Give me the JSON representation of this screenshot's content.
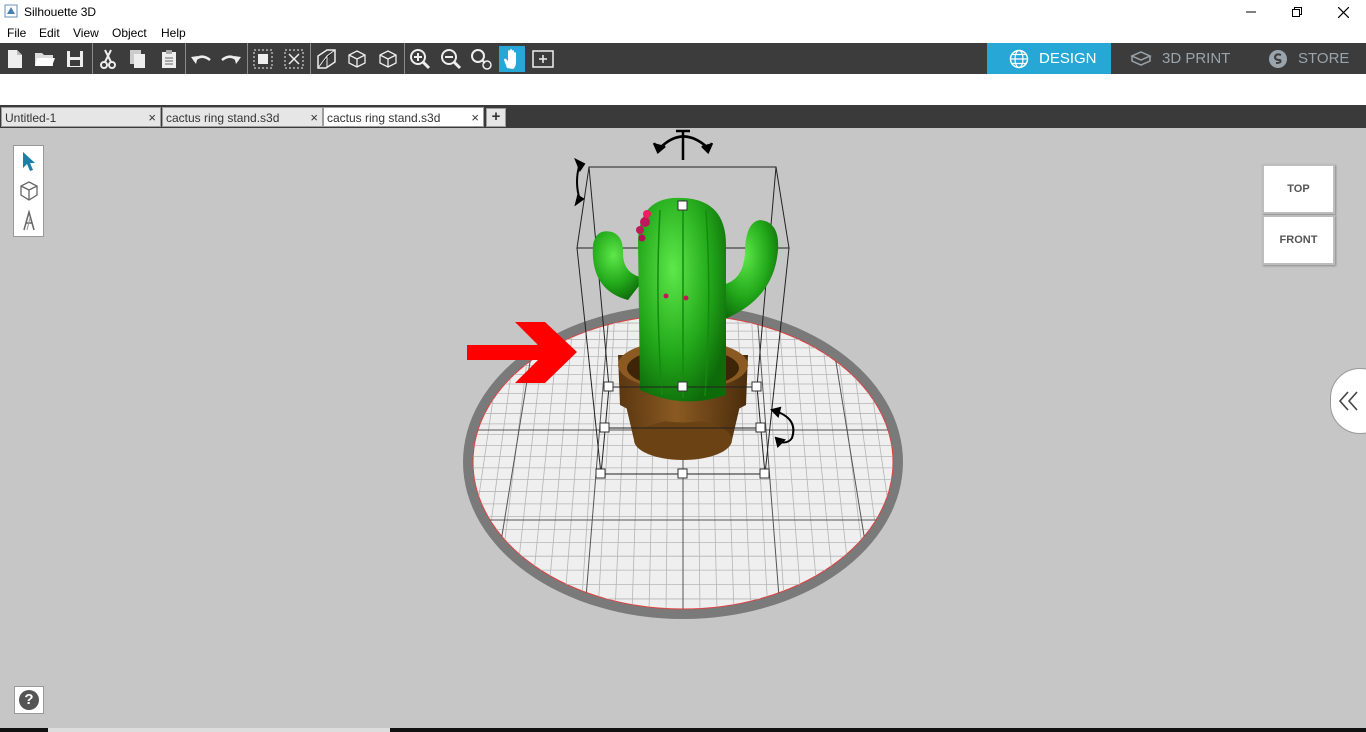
{
  "app": {
    "title": "Silhouette 3D"
  },
  "menu": {
    "file": "File",
    "edit": "Edit",
    "view": "View",
    "object": "Object",
    "help": "Help"
  },
  "modes": {
    "design": "DESIGN",
    "print": "3D PRINT",
    "store": "STORE"
  },
  "tabs": [
    {
      "label": "Untitled-1",
      "close": "×"
    },
    {
      "label": "cactus ring stand.s3d",
      "close": "×"
    },
    {
      "label": "cactus ring stand.s3d",
      "close": "×"
    }
  ],
  "add_tab": "+",
  "view_cube": {
    "top": "TOP",
    "front": "FRONT"
  },
  "help": "?",
  "colors": {
    "accent": "#26a7d6",
    "toolbar": "#3c3c3c",
    "viewport": "#c6c6c6",
    "cactus": "#22a81a",
    "pot": "#7a4e1c",
    "arrow": "#ff0000"
  }
}
